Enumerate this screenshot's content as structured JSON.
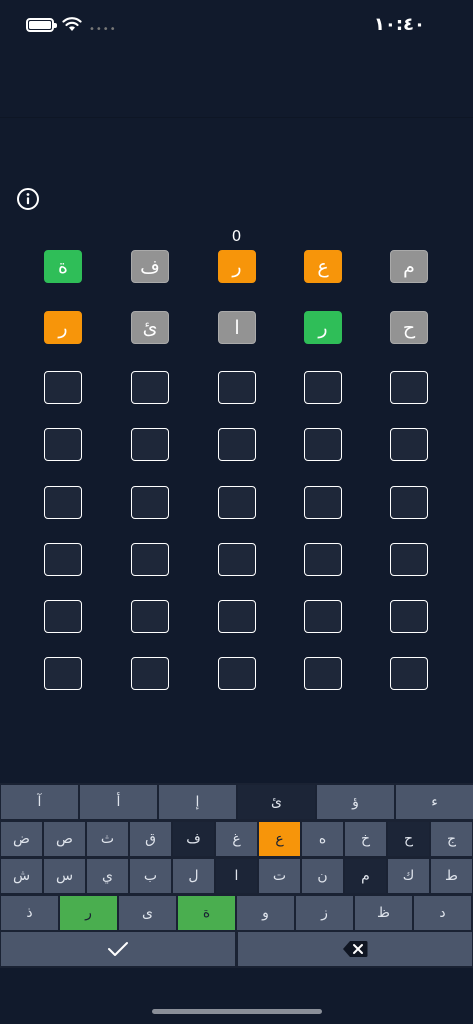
{
  "status_bar": {
    "time": "١٠:٤٠",
    "signal_dots": "••••"
  },
  "game": {
    "score": "0"
  },
  "board": {
    "rows": [
      [
        {
          "letter": "ة",
          "state": "green"
        },
        {
          "letter": "ف",
          "state": "gray"
        },
        {
          "letter": "ر",
          "state": "orange"
        },
        {
          "letter": "ع",
          "state": "orange"
        },
        {
          "letter": "م",
          "state": "gray"
        }
      ],
      [
        {
          "letter": "ر",
          "state": "orange"
        },
        {
          "letter": "ئ",
          "state": "gray"
        },
        {
          "letter": "ا",
          "state": "gray"
        },
        {
          "letter": "ر",
          "state": "green"
        },
        {
          "letter": "ح",
          "state": "gray"
        }
      ],
      [
        {
          "letter": "",
          "state": "empty"
        },
        {
          "letter": "",
          "state": "empty"
        },
        {
          "letter": "",
          "state": "empty"
        },
        {
          "letter": "",
          "state": "empty"
        },
        {
          "letter": "",
          "state": "empty"
        }
      ],
      [
        {
          "letter": "",
          "state": "empty"
        },
        {
          "letter": "",
          "state": "empty"
        },
        {
          "letter": "",
          "state": "empty"
        },
        {
          "letter": "",
          "state": "empty"
        },
        {
          "letter": "",
          "state": "empty"
        }
      ],
      [
        {
          "letter": "",
          "state": "empty"
        },
        {
          "letter": "",
          "state": "empty"
        },
        {
          "letter": "",
          "state": "empty"
        },
        {
          "letter": "",
          "state": "empty"
        },
        {
          "letter": "",
          "state": "empty"
        }
      ],
      [
        {
          "letter": "",
          "state": "empty"
        },
        {
          "letter": "",
          "state": "empty"
        },
        {
          "letter": "",
          "state": "empty"
        },
        {
          "letter": "",
          "state": "empty"
        },
        {
          "letter": "",
          "state": "empty"
        }
      ],
      [
        {
          "letter": "",
          "state": "empty"
        },
        {
          "letter": "",
          "state": "empty"
        },
        {
          "letter": "",
          "state": "empty"
        },
        {
          "letter": "",
          "state": "empty"
        },
        {
          "letter": "",
          "state": "empty"
        }
      ],
      [
        {
          "letter": "",
          "state": "empty"
        },
        {
          "letter": "",
          "state": "empty"
        },
        {
          "letter": "",
          "state": "empty"
        },
        {
          "letter": "",
          "state": "empty"
        },
        {
          "letter": "",
          "state": "empty"
        }
      ]
    ]
  },
  "keyboard": {
    "rows": [
      [
        {
          "label": "آ",
          "state": "normal"
        },
        {
          "label": "أ",
          "state": "normal"
        },
        {
          "label": "إ",
          "state": "normal"
        },
        {
          "label": "ئ",
          "state": "dark"
        },
        {
          "label": "ؤ",
          "state": "normal"
        },
        {
          "label": "ء",
          "state": "normal"
        }
      ],
      [
        {
          "label": "ض",
          "state": "normal"
        },
        {
          "label": "ص",
          "state": "normal"
        },
        {
          "label": "ث",
          "state": "normal"
        },
        {
          "label": "ق",
          "state": "normal"
        },
        {
          "label": "ف",
          "state": "dark"
        },
        {
          "label": "غ",
          "state": "normal"
        },
        {
          "label": "ع",
          "state": "orange"
        },
        {
          "label": "ه",
          "state": "normal"
        },
        {
          "label": "خ",
          "state": "normal"
        },
        {
          "label": "ح",
          "state": "dark"
        },
        {
          "label": "ج",
          "state": "normal"
        }
      ],
      [
        {
          "label": "ش",
          "state": "normal"
        },
        {
          "label": "س",
          "state": "normal"
        },
        {
          "label": "ي",
          "state": "normal"
        },
        {
          "label": "ب",
          "state": "normal"
        },
        {
          "label": "ل",
          "state": "normal"
        },
        {
          "label": "ا",
          "state": "dark"
        },
        {
          "label": "ت",
          "state": "normal"
        },
        {
          "label": "ن",
          "state": "normal"
        },
        {
          "label": "م",
          "state": "dark"
        },
        {
          "label": "ك",
          "state": "normal"
        },
        {
          "label": "ط",
          "state": "normal"
        }
      ],
      [
        {
          "label": "ذ",
          "state": "normal"
        },
        {
          "label": "ر",
          "state": "green"
        },
        {
          "label": "ى",
          "state": "normal"
        },
        {
          "label": "ة",
          "state": "green"
        },
        {
          "label": "و",
          "state": "normal"
        },
        {
          "label": "ز",
          "state": "normal"
        },
        {
          "label": "ظ",
          "state": "normal"
        },
        {
          "label": "د",
          "state": "normal"
        }
      ]
    ],
    "enter_icon": "checkmark-icon",
    "delete_icon": "backspace-icon"
  },
  "colors": {
    "background": "#111a2c",
    "correct": "#2fbe58",
    "present": "#f7950a",
    "absent": "#939393",
    "key_default": "#4b566b",
    "key_absent": "#1c2537"
  }
}
